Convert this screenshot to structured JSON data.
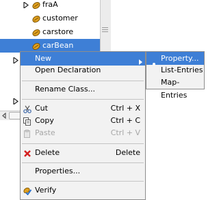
{
  "tree": {
    "items": [
      {
        "label": "fraA",
        "expandable": true
      },
      {
        "label": "customer",
        "expandable": false
      },
      {
        "label": "carstore",
        "expandable": false
      },
      {
        "label": "carBean",
        "expandable": false,
        "selected": true
      }
    ]
  },
  "menu": {
    "new": {
      "label": "New"
    },
    "open_declaration": {
      "label": "Open Declaration"
    },
    "rename_class": {
      "label": "Rename Class..."
    },
    "cut": {
      "label": "Cut",
      "shortcut": "Ctrl + X"
    },
    "copy": {
      "label": "Copy",
      "shortcut": "Ctrl + C"
    },
    "paste": {
      "label": "Paste",
      "shortcut": "Ctrl + V",
      "disabled": true
    },
    "delete": {
      "label": "Delete",
      "shortcut": "Delete"
    },
    "properties": {
      "label": "Properties..."
    },
    "verify": {
      "label": "Verify"
    }
  },
  "submenu": {
    "property": {
      "label": "Property..."
    },
    "list_entries": {
      "label": "List-Entries"
    },
    "map_entries": {
      "label": "Map-Entries"
    }
  },
  "colors": {
    "selection": "#3e7fd6",
    "menu_bg": "#f2f2f2",
    "bean_icon": "#e0a020"
  },
  "icons": [
    "expand-arrow-icon",
    "bean-icon",
    "cut-icon",
    "copy-icon",
    "paste-icon",
    "delete-icon",
    "verify-icon",
    "submenu-arrow-icon"
  ]
}
